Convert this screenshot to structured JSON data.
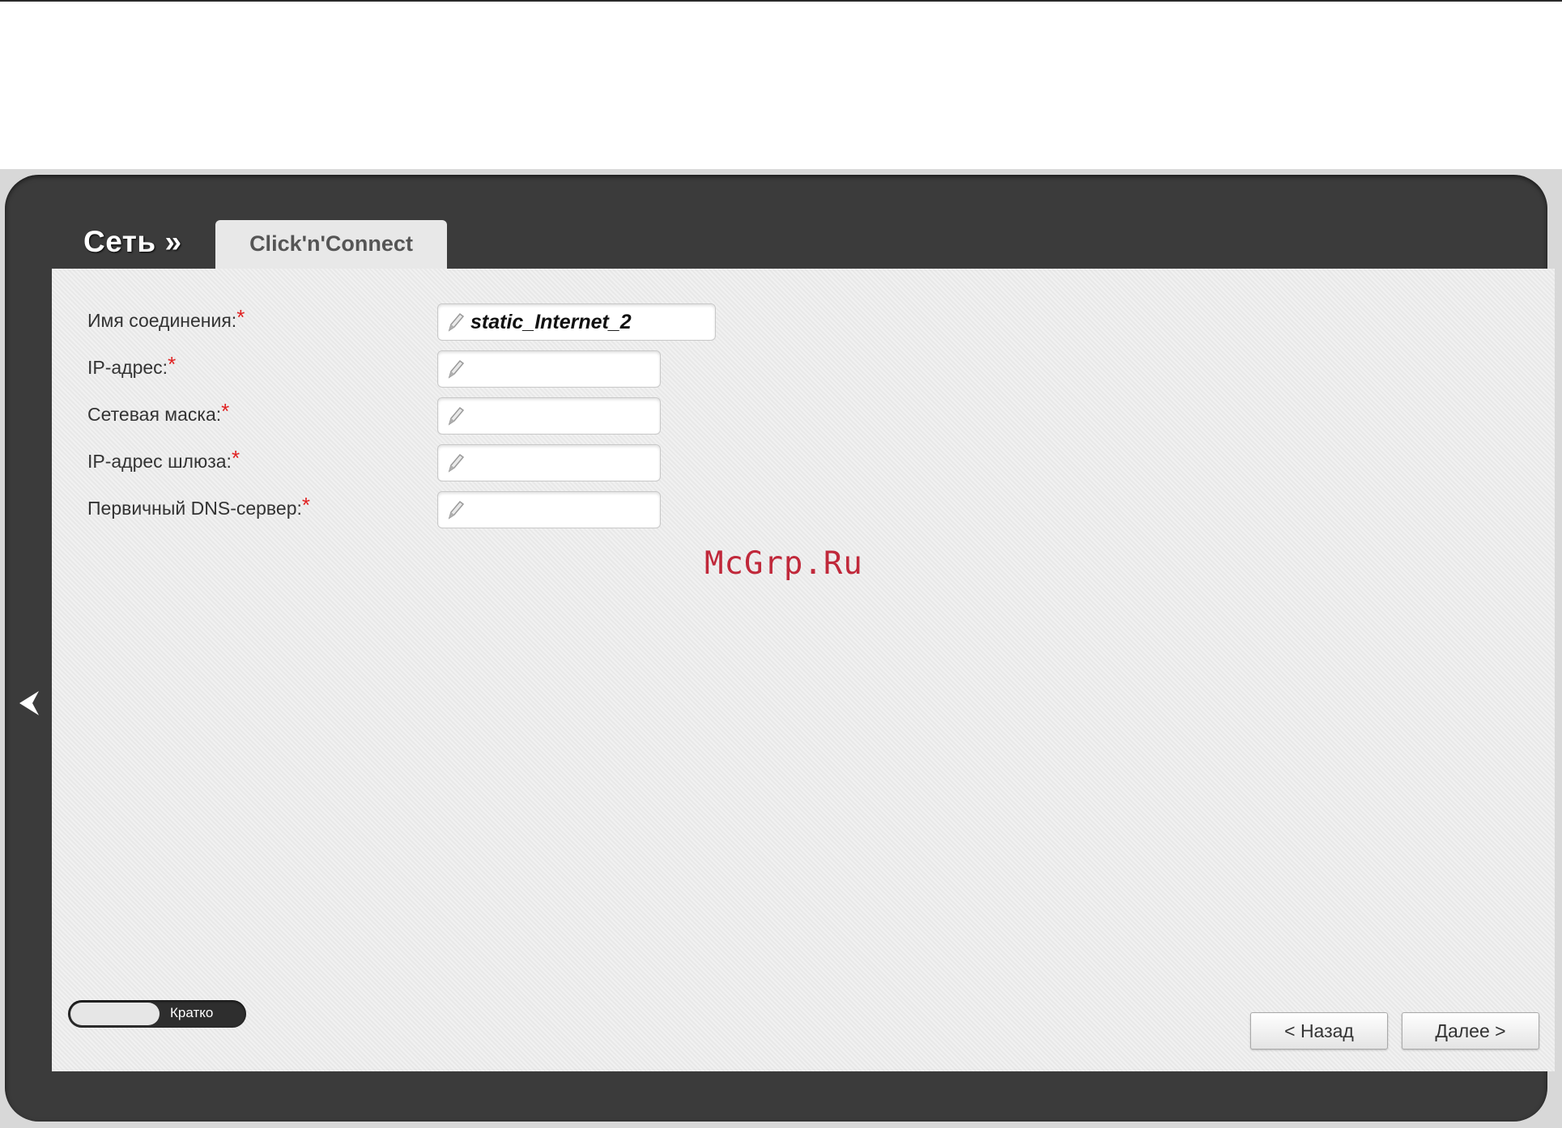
{
  "header": {
    "section_title": "Сеть »",
    "tab_label": "Click'n'Connect"
  },
  "form": {
    "required_mark": "*",
    "fields": [
      {
        "label": "Имя соединения:",
        "value": ""
      },
      {
        "label": "IP-адрес:",
        "value": ""
      },
      {
        "label": "Сетевая маска:",
        "value": ""
      },
      {
        "label": "IP-адрес шлюза:",
        "value": ""
      },
      {
        "label": "Первичный DNS-сервер:",
        "value": ""
      }
    ],
    "connection_name_value": "static_Internet_2"
  },
  "watermark": "McGrp.Ru",
  "footer": {
    "toggle_label": "Кратко",
    "back_button": "< Назад",
    "next_button": "Далее >"
  },
  "icons": {
    "edit": "pencil-icon",
    "back": "chevron-left-icon"
  },
  "colors": {
    "panel": "#3b3b3b",
    "content": "#ececec",
    "required": "#e02020",
    "watermark": "#c0283a"
  }
}
